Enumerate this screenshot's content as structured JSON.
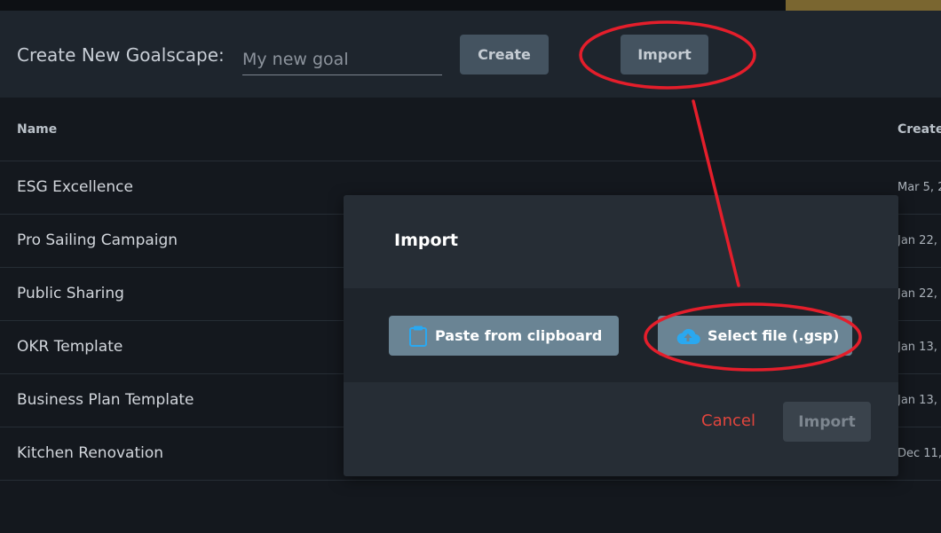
{
  "header": {
    "create_label": "Create New Goalscape:",
    "input_placeholder": "My new goal",
    "create_button": "Create",
    "import_button": "Import"
  },
  "table": {
    "columns": [
      "Name",
      "Create"
    ],
    "rows": [
      {
        "name": "ESG Excellence",
        "created": "Mar 5, 2"
      },
      {
        "name": "Pro Sailing Campaign",
        "created": "Jan 22,"
      },
      {
        "name": "Public Sharing",
        "created": "Jan 22,"
      },
      {
        "name": "OKR Template",
        "created": "Jan 13,"
      },
      {
        "name": "Business Plan Template",
        "created": "Jan 13,"
      },
      {
        "name": "Kitchen Renovation",
        "created": "Dec 11,"
      }
    ]
  },
  "modal": {
    "title": "Import",
    "paste_button": "Paste from clipboard",
    "select_file_button": "Select file (.gsp)",
    "cancel_button": "Cancel",
    "import_button": "Import"
  },
  "icons": {
    "paste": "clipboard-icon",
    "select_file": "cloud-upload-icon"
  },
  "colors": {
    "annotation": "#e41e2b",
    "icon_accent": "#2aa8f0",
    "cancel": "#e0453d"
  }
}
